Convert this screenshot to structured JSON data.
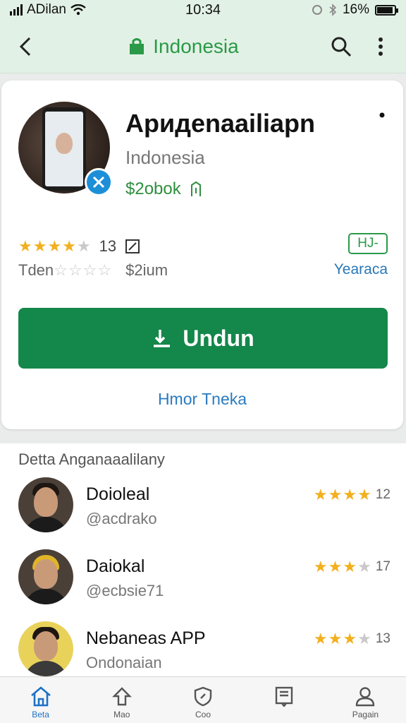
{
  "status_bar": {
    "carrier": "ADilan",
    "time": "10:34",
    "battery": "16%"
  },
  "app_bar": {
    "title": "Indonesia"
  },
  "app": {
    "name": "Apидenaailiapn",
    "developer": "Indonesia",
    "price": "$2obok",
    "rating_count": "13",
    "tag_outline": "HJ-",
    "rating_label": "Tden",
    "price_label": "$2ium",
    "category": "Yearaca",
    "install_label": "Undun",
    "more_link": "Hmor Tneka"
  },
  "list": {
    "title": "Detta Anganaaalilany",
    "items": [
      {
        "name": "Doioleal",
        "handle": "@acdrako",
        "count": "12",
        "stars": 4
      },
      {
        "name": "Daiokal",
        "handle": "@ecbsie71",
        "count": "17",
        "stars": 3
      },
      {
        "name": "Nebaneas APP",
        "handle": "Ondonaian",
        "count": "13",
        "stars": 3
      }
    ]
  },
  "bottom_nav": {
    "items": [
      {
        "label": "Beta",
        "icon": "home-icon"
      },
      {
        "label": "Mao",
        "icon": "upload-icon"
      },
      {
        "label": "Coo",
        "icon": "shield-icon"
      },
      {
        "label": "",
        "icon": "book-icon"
      },
      {
        "label": "Pagain",
        "icon": "person-icon"
      }
    ]
  },
  "colors": {
    "accent_green": "#2a9a48",
    "install_green": "#14874a",
    "link_blue": "#2a7bbf",
    "star_yellow": "#f2b01e"
  }
}
